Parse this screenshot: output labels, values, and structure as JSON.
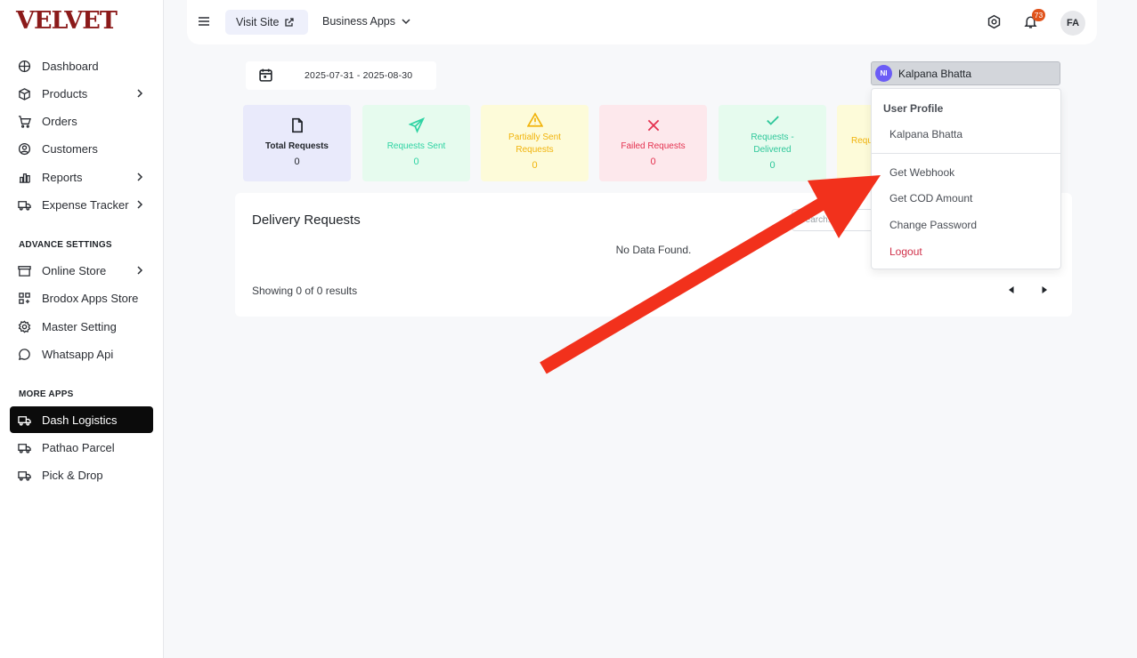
{
  "brand": {
    "logo_text": "VELVET",
    "logo_color": "#8b1a1a"
  },
  "sidebar": {
    "items": [
      {
        "label": "Dashboard",
        "icon": "dashboard-icon",
        "chevron": false
      },
      {
        "label": "Products",
        "icon": "box-icon",
        "chevron": true
      },
      {
        "label": "Orders",
        "icon": "cart-icon",
        "chevron": false
      },
      {
        "label": "Customers",
        "icon": "user-icon",
        "chevron": false
      },
      {
        "label": "Reports",
        "icon": "chart-icon",
        "chevron": true
      },
      {
        "label": "Expense Tracker",
        "icon": "truck-icon",
        "chevron": true
      }
    ],
    "advance_label": "ADVANCE SETTINGS",
    "advance_items": [
      {
        "label": "Online Store",
        "icon": "store-icon",
        "chevron": true
      },
      {
        "label": "Brodox Apps Store",
        "icon": "apps-icon",
        "chevron": false
      },
      {
        "label": "Master Setting",
        "icon": "gear-icon",
        "chevron": false
      },
      {
        "label": "Whatsapp Api",
        "icon": "chat-icon",
        "chevron": false
      }
    ],
    "more_label": "MORE APPS",
    "more_items": [
      {
        "label": "Dash Logistics",
        "icon": "truck-icon",
        "active": true
      },
      {
        "label": "Pathao Parcel",
        "icon": "truck-icon",
        "active": false
      },
      {
        "label": "Pick & Drop",
        "icon": "truck-icon",
        "active": false
      }
    ]
  },
  "topbar": {
    "visit_site": "Visit Site",
    "business_apps": "Business Apps",
    "notification_count": "73",
    "avatar_initials": "FA"
  },
  "filters": {
    "date_range": "2025-07-31 - 2025-08-30",
    "user_select_initials": "NI",
    "user_select_name": "Kalpana Bhatta"
  },
  "cards": [
    {
      "label": "Total Requests",
      "value": "0",
      "bg": "#e9eafb",
      "fg": "#1f2328",
      "icon": "file-icon"
    },
    {
      "label": "Requests Sent",
      "value": "0",
      "bg": "#e6fbee",
      "fg": "#2ed3a3",
      "icon": "send-icon"
    },
    {
      "label": "Partially Sent Requests",
      "value": "0",
      "bg": "#fdfbd9",
      "fg": "#f1b30a",
      "icon": "warning-icon"
    },
    {
      "label": "Failed Requests",
      "value": "0",
      "bg": "#fde8ec",
      "fg": "#e4314f",
      "icon": "x-icon"
    },
    {
      "label": "Requests - Delivered",
      "value": "0",
      "bg": "#e6fbee",
      "fg": "#2ec79a",
      "icon": "check-icon"
    },
    {
      "label": "Requ",
      "value": "",
      "bg": "#fdfbd9",
      "fg": "#f1b30a",
      "icon": ""
    }
  ],
  "panel": {
    "title": "Delivery Requests",
    "search_placeholder": "Search...",
    "empty_text": "No Data Found.",
    "showing_text": "Showing 0 of 0 results"
  },
  "dropdown": {
    "header": "User Profile",
    "name": "Kalpana Bhatta",
    "items": [
      "Get Webhook",
      "Get COD Amount",
      "Change Password"
    ],
    "logout": "Logout"
  },
  "annotation_color": "#f2311c"
}
